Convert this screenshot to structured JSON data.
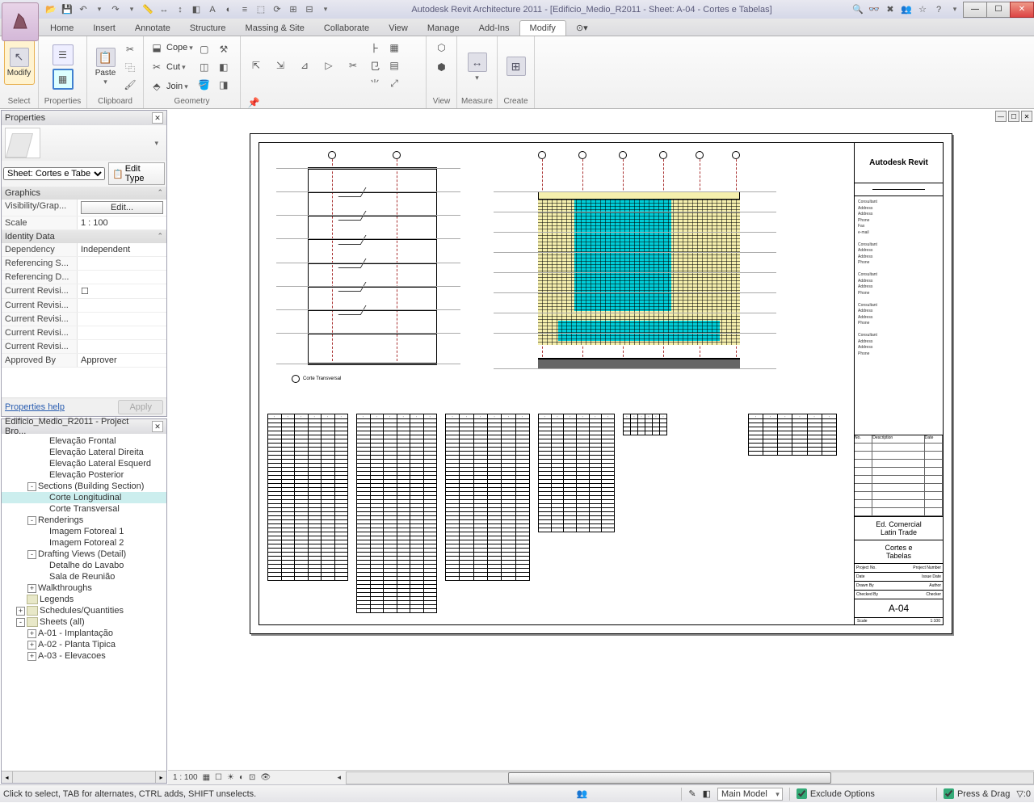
{
  "title": "Autodesk Revit Architecture 2011 - [Edificio_Medio_R2011 - Sheet: A-04 - Cortes e Tabelas]",
  "ribbonTabs": [
    "Home",
    "Insert",
    "Annotate",
    "Structure",
    "Massing & Site",
    "Collaborate",
    "View",
    "Manage",
    "Add-Ins",
    "Modify"
  ],
  "activeTab": "Modify",
  "ribbonGroups": {
    "select": "Select",
    "modifyBtn": "Modify",
    "properties": "Properties",
    "clipboard": "Clipboard",
    "paste": "Paste",
    "geometry": "Geometry",
    "cope": "Cope",
    "cut": "Cut",
    "join": "Join",
    "modify": "Modify",
    "view": "View",
    "measure": "Measure",
    "create": "Create"
  },
  "properties": {
    "title": "Properties",
    "type": "Sheet: Cortes e Tabe",
    "editType": "Edit Type",
    "sections": {
      "graphics": "Graphics",
      "identity": "Identity Data"
    },
    "rows": [
      {
        "k": "Visibility/Grap...",
        "v": "Edit...",
        "btn": true
      },
      {
        "k": "Scale",
        "v": "1 : 100"
      }
    ],
    "identityRows": [
      {
        "k": "Dependency",
        "v": "Independent"
      },
      {
        "k": "Referencing S...",
        "v": ""
      },
      {
        "k": "Referencing D...",
        "v": ""
      },
      {
        "k": "Current Revisi...",
        "v": "☐"
      },
      {
        "k": "Current Revisi...",
        "v": ""
      },
      {
        "k": "Current Revisi...",
        "v": ""
      },
      {
        "k": "Current Revisi...",
        "v": ""
      },
      {
        "k": "Current Revisi...",
        "v": ""
      },
      {
        "k": "Approved By",
        "v": "Approver"
      }
    ],
    "helpLink": "Properties help",
    "apply": "Apply"
  },
  "browser": {
    "title": "Edificio_Medio_R2011 - Project Bro...",
    "items": [
      {
        "indent": 3,
        "label": "Elevação Frontal"
      },
      {
        "indent": 3,
        "label": "Elevação Lateral Direita"
      },
      {
        "indent": 3,
        "label": "Elevação Lateral Esquerd"
      },
      {
        "indent": 3,
        "label": "Elevação Posterior"
      },
      {
        "indent": 2,
        "toggle": "-",
        "label": "Sections (Building Section)"
      },
      {
        "indent": 3,
        "label": "Corte Longitudinal",
        "sel": true
      },
      {
        "indent": 3,
        "label": "Corte Transversal"
      },
      {
        "indent": 2,
        "toggle": "-",
        "label": "Renderings"
      },
      {
        "indent": 3,
        "label": "Imagem Fotoreal 1"
      },
      {
        "indent": 3,
        "label": "Imagem Fotoreal 2"
      },
      {
        "indent": 2,
        "toggle": "-",
        "label": "Drafting Views (Detail)"
      },
      {
        "indent": 3,
        "label": "Detalhe do Lavabo"
      },
      {
        "indent": 3,
        "label": "Sala de Reunião"
      },
      {
        "indent": 2,
        "toggle": "+",
        "label": "Walkthroughs"
      },
      {
        "indent": 1,
        "icon": true,
        "label": "Legends"
      },
      {
        "indent": 1,
        "toggle": "+",
        "icon": true,
        "label": "Schedules/Quantities"
      },
      {
        "indent": 1,
        "toggle": "-",
        "icon": true,
        "label": "Sheets (all)"
      },
      {
        "indent": 2,
        "toggle": "+",
        "label": "A-01 - Implantação"
      },
      {
        "indent": 2,
        "toggle": "+",
        "label": "A-02 - Planta Tipica"
      },
      {
        "indent": 2,
        "toggle": "+",
        "label": "A-03 - Elevacoes"
      }
    ]
  },
  "sheet": {
    "logo": "Autodesk Revit",
    "project1": "Ed. Comercial",
    "project2": "Latin Trade",
    "sheetName1": "Cortes e",
    "sheetName2": "Tabelas",
    "number": "A-04",
    "scale": "1:100",
    "section1": "Corte Transversal",
    "revHeader": {
      "no": "No.",
      "desc": "Description",
      "date": "Date"
    },
    "meta": [
      [
        "Project No.",
        "Project Number"
      ],
      [
        "Date",
        "Issue Date"
      ],
      [
        "Drawn By",
        "Author"
      ],
      [
        "Checked By",
        "Checker"
      ]
    ]
  },
  "statusbar": {
    "hint": "Click to select, TAB for alternates, CTRL adds, SHIFT unselects.",
    "model": "Main Model",
    "exclude": "Exclude Options",
    "press": "Press & Drag",
    "filter": "0"
  },
  "viewbar": "1 : 100"
}
